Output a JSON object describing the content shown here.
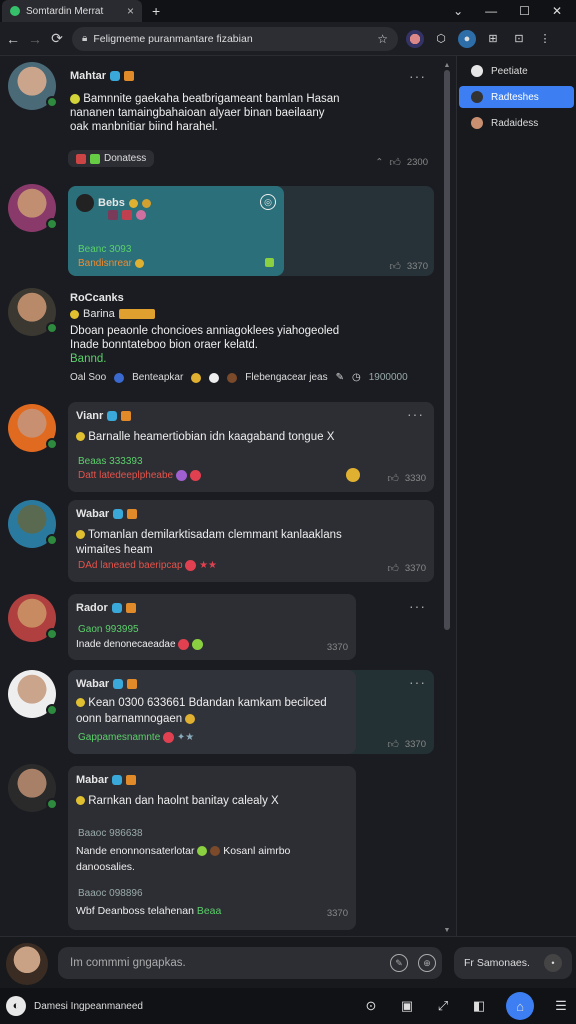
{
  "browser": {
    "tab_title": "Somtardin Merrat",
    "address": "Feligmeme puranmantare fizabian",
    "back_icon": "arrow-left-icon",
    "forward_icon": "arrow-right-icon",
    "reload_icon": "reload-icon",
    "lock_icon": "lock-icon",
    "star_icon": "star-icon"
  },
  "sidebar_right": {
    "items": [
      {
        "label": "Peetiate",
        "active": false
      },
      {
        "label": "Radteshes",
        "active": true
      },
      {
        "label": "Radaidess",
        "active": false
      }
    ]
  },
  "posts": [
    {
      "name": "Mahtar",
      "text1": "Bamnnite gaekaha beatbrigameant bamlan Hasan",
      "text2": "nananen tamaingbahaioan alyaer binan baeilaany",
      "text3": "oak manbnitiar biind harahel.",
      "chip": "Donatess",
      "stat": "2300"
    },
    {
      "name": "Bebs",
      "line1": "Beanc 3093",
      "line2": "Bandisnrear",
      "stat": "3370"
    },
    {
      "name": "RoCcanks",
      "sub": "Barina",
      "text1": "Dboan peaonle choncioes anniagoklees yiahogeoled",
      "text2": "Inade bonntateboo bion oraer kelatd.",
      "text3": "Bannd.",
      "f1": "Oal Soo",
      "f2": "Benteapkar",
      "f3": "Flebengacear jeas",
      "stat": "1900000"
    },
    {
      "name": "Vianr",
      "text1": "Barnalle heamertiobian idn kaagaband tongue X",
      "line1": "Beaas 333393",
      "line2": "Datt latedeeplpheabe",
      "stat": "3330"
    },
    {
      "name": "Wabar",
      "text1": "Tomanlan demilarktisadam clemmant kanlaaklans",
      "text2": "wimaites heam",
      "line1": "DAd laneaed baeripcap",
      "stat": "3370"
    },
    {
      "name": "Rador",
      "line1": "Gaon 993995",
      "line2": "Inade denonecaeadae",
      "stat": "3370"
    },
    {
      "name": "Wabar",
      "text1": "Kean 0300 633661 Bdandan kamkam becilced",
      "text2": "oonn barnamnogaen",
      "line1": "Gappamesnamnte",
      "stat": "3370"
    },
    {
      "name": "Mabar",
      "text1": "Rarnkan dan haolnt banitay calealy X",
      "line1": "Baaoc 986638",
      "text2": "Nande enonnonsaterlotar",
      "text2b": "Kosanl aimrbo",
      "text3": "danoosalies.",
      "line2": "Baaoc 098896",
      "text4": "Wbf Deanboss telahenan",
      "text4b": "Beaa",
      "stat": "3370"
    }
  ],
  "composer": {
    "placeholder": "Im commmi gngapkas.",
    "right_label": "Fr Samonaes."
  },
  "bottom": {
    "label": "Damesi Ingpeanmaneed"
  },
  "colors": {
    "accent": "#3d7ff2",
    "teal_card": "#2b6f7a",
    "green_text": "#5bd06a",
    "red_text": "#e4534b"
  }
}
